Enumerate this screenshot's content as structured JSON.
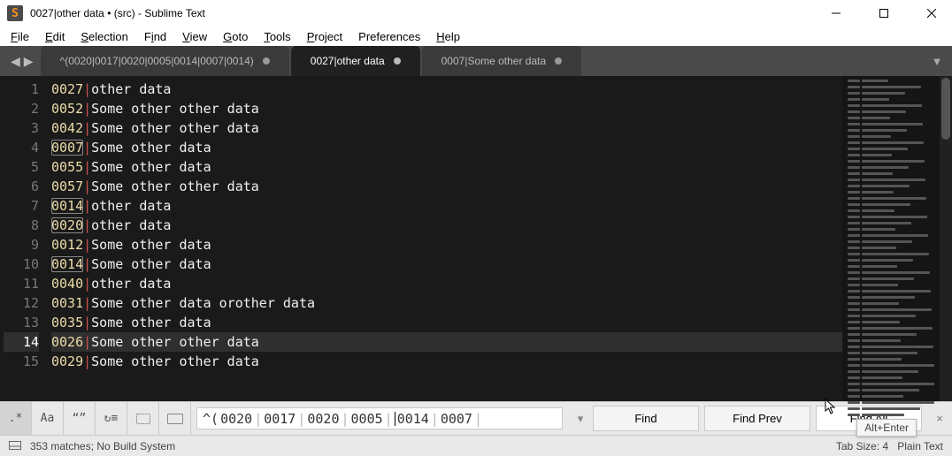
{
  "window": {
    "title": "0027|other data • (src) - Sublime Text"
  },
  "menu": {
    "file": "File",
    "edit": "Edit",
    "selection": "Selection",
    "find": "Find",
    "view": "View",
    "goto": "Goto",
    "tools": "Tools",
    "project": "Project",
    "preferences": "Preferences",
    "help": "Help"
  },
  "tabs": [
    {
      "label": "^(0020|0017|0020|0005|0014|0007|0014)",
      "active": false,
      "dirty": true
    },
    {
      "label": "0027|other data",
      "active": true,
      "dirty": true
    },
    {
      "label": "0007|Some other data",
      "active": false,
      "dirty": true
    }
  ],
  "editor": {
    "active_line": 14,
    "lines": [
      {
        "n": 1,
        "num": "0027",
        "text": "other data",
        "hl": false
      },
      {
        "n": 2,
        "num": "0052",
        "text": "Some other other data",
        "hl": false
      },
      {
        "n": 3,
        "num": "0042",
        "text": "Some other other data",
        "hl": false
      },
      {
        "n": 4,
        "num": "0007",
        "text": "Some other data",
        "hl": true
      },
      {
        "n": 5,
        "num": "0055",
        "text": "Some other data",
        "hl": false
      },
      {
        "n": 6,
        "num": "0057",
        "text": "Some other other data",
        "hl": false
      },
      {
        "n": 7,
        "num": "0014",
        "text": "other data",
        "hl": true
      },
      {
        "n": 8,
        "num": "0020",
        "text": "other data",
        "hl": true
      },
      {
        "n": 9,
        "num": "0012",
        "text": "Some other data",
        "hl": false
      },
      {
        "n": 10,
        "num": "0014",
        "text": "Some other data",
        "hl": true
      },
      {
        "n": 11,
        "num": "0040",
        "text": "other data",
        "hl": false
      },
      {
        "n": 12,
        "num": "0031",
        "text": "Some other data orother data",
        "hl": false
      },
      {
        "n": 13,
        "num": "0035",
        "text": "Some other data",
        "hl": false
      },
      {
        "n": 14,
        "num": "0026",
        "text": "Some other other data",
        "hl": false
      },
      {
        "n": 15,
        "num": "0029",
        "text": "Some other other data",
        "hl": false
      }
    ]
  },
  "find": {
    "regex_icon": ".*",
    "case_icon": "Aa",
    "whole_icon": "“”",
    "wrap_icon": "↻≡",
    "selection_icon": "⧉",
    "highlight_icon": "▭",
    "query_prefix": "^(",
    "query_groups": [
      "0020",
      "0017",
      "0020",
      "0005",
      "0014",
      "0007"
    ],
    "history_icon": "▾",
    "find_label": "Find",
    "find_prev_label": "Find Prev",
    "find_all_label": "Find All",
    "close_icon": "×",
    "tooltip": "Alt+Enter"
  },
  "status": {
    "matches": "353 matches; No Build System",
    "tab_size": "Tab Size: 4",
    "syntax": "Plain Text"
  }
}
